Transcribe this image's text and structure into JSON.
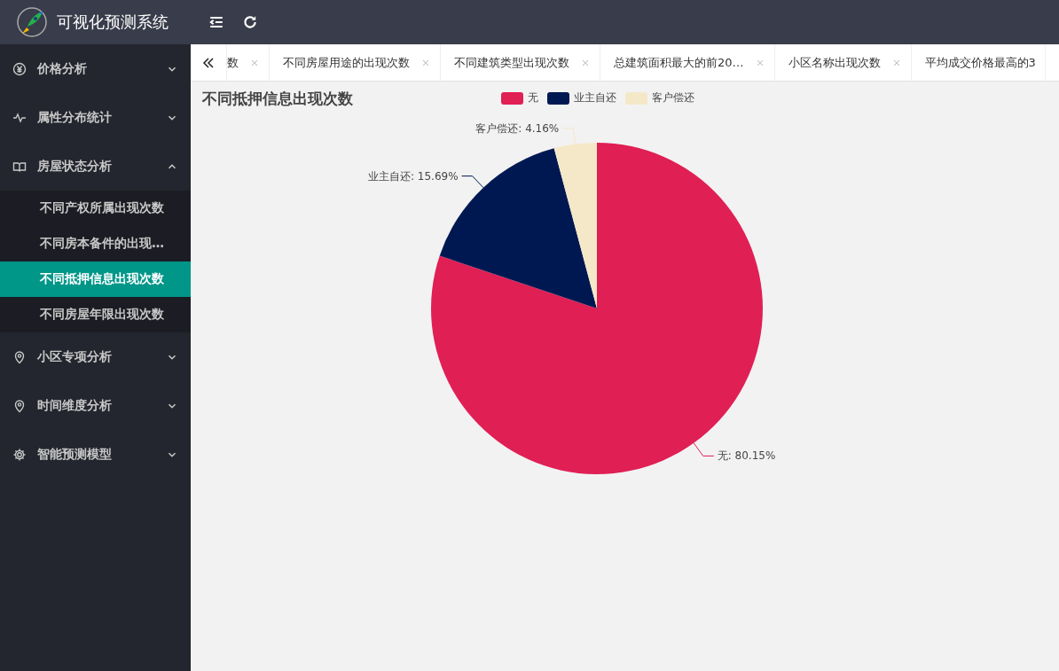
{
  "header": {
    "title": "可视化预测系统"
  },
  "sidebar": {
    "items": [
      {
        "label": "价格分析",
        "expanded": false
      },
      {
        "label": "属性分布统计",
        "expanded": false
      },
      {
        "label": "房屋状态分析",
        "expanded": true,
        "children": [
          {
            "label": "不同产权所属出现次数",
            "selected": false
          },
          {
            "label": "不同房本备件的出现…",
            "selected": false
          },
          {
            "label": "不同抵押信息出现次数",
            "selected": true
          },
          {
            "label": "不同房屋年限出现次数",
            "selected": false
          }
        ]
      },
      {
        "label": "小区专项分析",
        "expanded": false
      },
      {
        "label": "时间维度分析",
        "expanded": false
      },
      {
        "label": "智能预测模型",
        "expanded": false
      }
    ]
  },
  "tabs": [
    {
      "label": "数",
      "closable": true
    },
    {
      "label": "不同房屋用途的出现次数",
      "closable": true
    },
    {
      "label": "不同建筑类型出现次数",
      "closable": true
    },
    {
      "label": "总建筑面积最大的前20…",
      "closable": true
    },
    {
      "label": "小区名称出现次数",
      "closable": true
    },
    {
      "label": "平均成交价格最高的3",
      "closable": false
    }
  ],
  "chart": {
    "chart_data": {
      "type": "pie",
      "title": "不同抵押信息出现次数",
      "categories": [
        "无",
        "业主自还",
        "客户偿还"
      ],
      "values": [
        80.15,
        15.69,
        4.16
      ],
      "colors": [
        "#e01f54",
        "#001852",
        "#f5e8c8"
      ],
      "legend": "top",
      "value_labels": [
        "无: 80.15%",
        "业主自还: 15.69%",
        "客户偿还: 4.16%"
      ]
    }
  }
}
